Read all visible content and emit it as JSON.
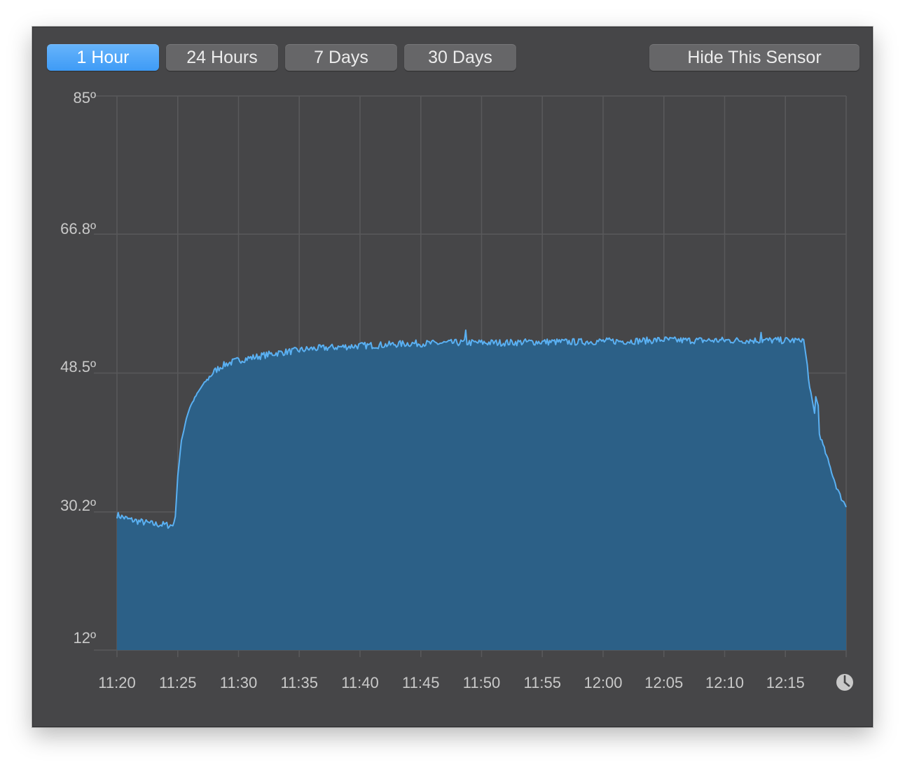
{
  "toolbar": {
    "buttons": [
      {
        "label": "1 Hour",
        "active": true
      },
      {
        "label": "24 Hours",
        "active": false
      },
      {
        "label": "7 Days",
        "active": false
      },
      {
        "label": "30 Days",
        "active": false
      }
    ],
    "hide_label": "Hide This Sensor"
  },
  "colors": {
    "background": "#464648",
    "grid": "#59595b",
    "area_fill": "#2c6087",
    "line": "#5ab0f2",
    "active_button": "#4aa3f8",
    "button": "#666668",
    "text": "#c9c9c9"
  },
  "icons": {
    "clock": "clock-icon"
  },
  "chart_data": {
    "type": "area",
    "title": "",
    "xlabel": "",
    "ylabel": "",
    "ylim": [
      12,
      85
    ],
    "y_ticks": [
      "85º",
      "66.8º",
      "48.5º",
      "30.2º",
      "12º"
    ],
    "y_tick_values": [
      85,
      66.8,
      48.5,
      30.2,
      12
    ],
    "x_ticks": [
      "11:20",
      "11:25",
      "11:30",
      "11:35",
      "11:40",
      "11:45",
      "11:50",
      "11:55",
      "12:00",
      "12:05",
      "12:10",
      "12:15"
    ],
    "grid": true,
    "x_unit": "minutes from 11:20",
    "x": [
      0,
      1,
      2,
      3,
      4,
      4.6,
      4.8,
      5.0,
      5.3,
      5.7,
      6.0,
      6.5,
      7.0,
      7.5,
      8.0,
      8.5,
      9.0,
      10,
      11,
      12,
      13,
      14,
      15,
      16,
      18,
      20,
      22,
      24,
      26,
      28,
      30,
      32,
      34,
      36,
      38,
      40,
      42,
      44,
      45,
      46,
      56.1,
      56.5,
      56.8,
      57.0,
      57.3,
      57.6,
      58.0,
      58.4,
      58.8,
      59.2,
      59.6,
      60
    ],
    "values": [
      29.8,
      29.2,
      28.9,
      28.6,
      28.5,
      28.4,
      29.5,
      35.0,
      39.5,
      42.5,
      44.0,
      45.5,
      46.8,
      47.8,
      48.7,
      49.3,
      49.7,
      50.2,
      50.5,
      50.8,
      51.1,
      51.3,
      51.5,
      51.7,
      51.9,
      52.1,
      52.2,
      52.4,
      52.4,
      52.5,
      52.5,
      52.5,
      52.6,
      52.6,
      52.6,
      52.7,
      52.7,
      52.8,
      52.9,
      52.8,
      52.8,
      52.9,
      49.5,
      46.5,
      44.0,
      41.5,
      39.5,
      37.5,
      35.5,
      33.5,
      32.0,
      31.0
    ]
  }
}
